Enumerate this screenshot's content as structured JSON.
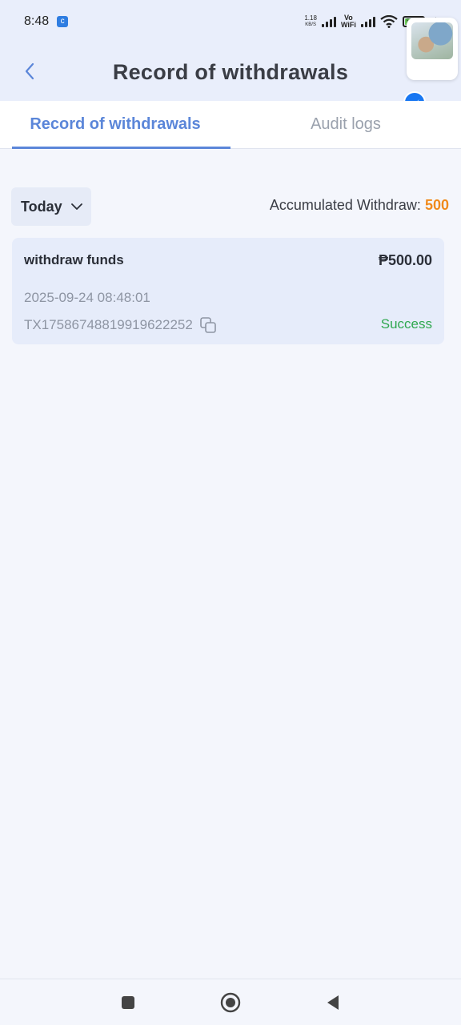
{
  "status_bar": {
    "time": "8:48",
    "speed_value": "1.18",
    "speed_unit": "KB/S",
    "vowifi_top": "Vo",
    "vowifi_bottom": "WiFi",
    "battery": "57"
  },
  "header": {
    "title": "Record of withdrawals"
  },
  "tabs": [
    {
      "label": "Record of withdrawals",
      "active": true
    },
    {
      "label": "Audit logs",
      "active": false
    }
  ],
  "filter": {
    "selected": "Today"
  },
  "summary": {
    "label": "Accumulated Withdraw:",
    "value": "500"
  },
  "records": [
    {
      "title": "withdraw funds",
      "amount": "₱500.00",
      "datetime": "2025-09-24 08:48:01",
      "tx_id": "TX17586748819919622252",
      "status": "Success"
    }
  ],
  "colors": {
    "accent": "#5b86d9",
    "success": "#2fa84f",
    "highlight": "#f08a1c"
  }
}
